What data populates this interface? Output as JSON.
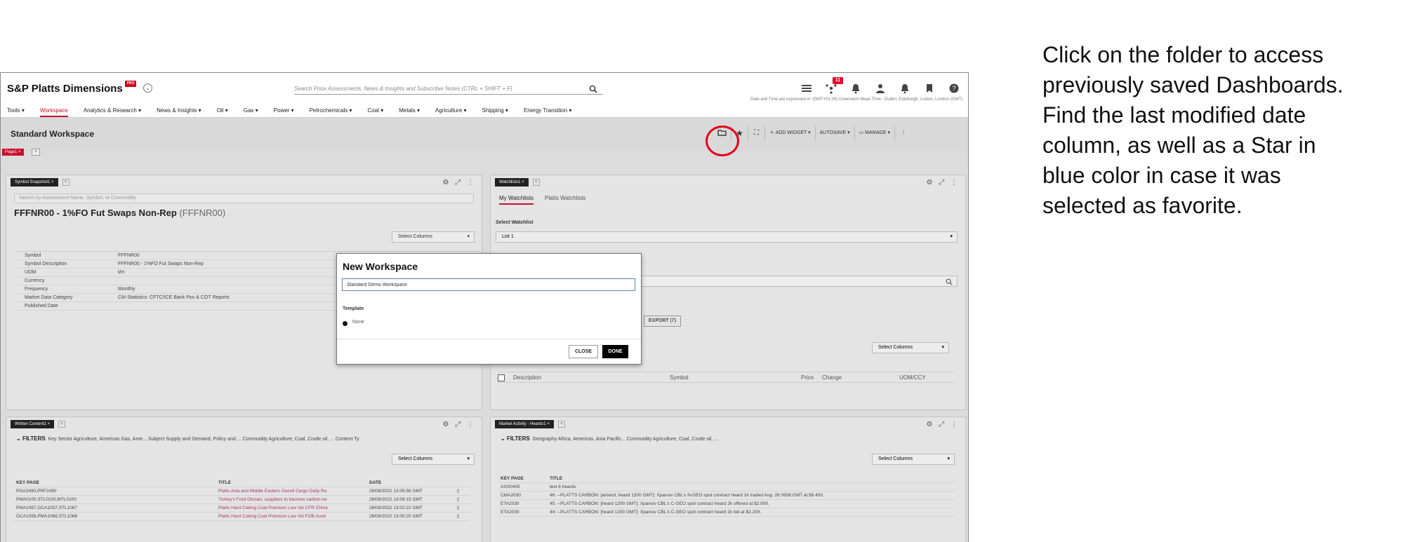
{
  "app": {
    "brand": "S&P Platts Dimensions",
    "brand_badge": "PRO",
    "search_placeholder": "Search Price Assessments, News & Insights and Subscriber Notes (CTRL + SHIFT + F)",
    "notification_count": "11",
    "timezone_text": "Date and Time are expressed in: (GMT+01:00) Greenwich Mean Time : Dublin, Edinburgh, Lisbon, London (GMT)"
  },
  "menu": [
    {
      "label": "Tools",
      "active": false
    },
    {
      "label": "Workspace",
      "active": true
    },
    {
      "label": "Analytics & Research",
      "active": false
    },
    {
      "label": "News & Insights",
      "active": false
    },
    {
      "label": "Oil",
      "active": false
    },
    {
      "label": "Gas",
      "active": false
    },
    {
      "label": "Power",
      "active": false
    },
    {
      "label": "Petrochemicals",
      "active": false
    },
    {
      "label": "Coal",
      "active": false
    },
    {
      "label": "Metals",
      "active": false
    },
    {
      "label": "Agriculture",
      "active": false
    },
    {
      "label": "Shipping",
      "active": false
    },
    {
      "label": "Energy Transition",
      "active": false
    }
  ],
  "workspace": {
    "title": "Standard Workspace",
    "page_tab": "Page1",
    "toolbar": {
      "add_widget": "ADD WIDGET",
      "autosave": "AUTOSAVE",
      "manage": "MANAGE"
    }
  },
  "symbol_snapshot": {
    "tab": "Symbol Snapshot1",
    "search_placeholder": "Search by Assessment Name, Symbol, or Commodity",
    "title": "FFFNR00 - 1%FO Fut Swaps Non-Rep",
    "title_code": "(FFFNR00)",
    "select_columns": "Select Columns",
    "rows": [
      {
        "key": "Symbol",
        "value": "FFFNR00"
      },
      {
        "key": "Symbol Description",
        "value": "FFFNR00 - 1%FO Fut Swaps Non-Rep"
      },
      {
        "key": "UOM",
        "value": "t/m"
      },
      {
        "key": "Currency",
        "value": ""
      },
      {
        "key": "Frequency",
        "value": "Monthly"
      },
      {
        "key": "Market Data Category",
        "value": "CM-Statistics: CFTC/ICE Bank Pos & COT Reports"
      },
      {
        "key": "Published Date",
        "value": ""
      }
    ]
  },
  "watchlist": {
    "tab": "Watchlists1",
    "subtab_active": "My Watchlists",
    "subtab_other": "Platts Watchlists",
    "select_label": "Select Watchlist",
    "selected": "List 1",
    "export": "EXPORT (7)",
    "select_columns": "Select Columns",
    "col_description": "Description",
    "col_symbol": "Symbol",
    "col_price": "Price",
    "col_change": "Change",
    "col_uom": "UOM/CCY"
  },
  "written_content": {
    "tab": "Written Content1",
    "filters_label": "FILTERS",
    "filters_text": "Key Sector Agriculture, Americas Gas, Ame...  Subject Supply and Demand, Policy and ...  Commodity Agriculture, Coal, Crude oil, ...  Content Ty",
    "select_columns": "Select Columns",
    "headers": {
      "key_page": "KEY PAGE",
      "title": "TITLE",
      "date": "DATE"
    },
    "rows": [
      {
        "key": "PGA2490,PRF2490",
        "title": "Platts Asia and Middle Eastern Gasoil Cargo Daily Ra",
        "date": "26/08/2022 13:09:56 GMT"
      },
      {
        "key": "PMA0100,STL0100,MTL0100",
        "title": "Turkey's Ford Otosan, suppliers to become carbon-ne",
        "date": "26/08/2022 13:09:15 GMT"
      },
      {
        "key": "PMA1067,GCA1057,STL1067",
        "title": "Platts Hard Coking Coal Premium Low Vol CFR China",
        "date": "26/08/2022 13:02:22 GMT"
      },
      {
        "key": "GCA1058,PMA1068,STL1068",
        "title": "Platts Hard Coking Coal Premium Low Vol FOB Austr",
        "date": "26/08/2022 13:00:20 GMT"
      }
    ]
  },
  "market_activity": {
    "tab": "Market Activity - Heards1",
    "filters_label": "FILTERS",
    "filters_text": "Geography Africa, Americas, Asia Pacific...  Commodity Agriculture, Coal, Crude oil, ...",
    "select_columns": "Select Columns",
    "headers": {
      "key_page": "KEY PAGE",
      "title": "TITLE"
    },
    "rows": [
      {
        "key": "AXX0400",
        "title": "test 8 heards"
      },
      {
        "key": "CMA2030",
        "title": "46: --PLATTS CARBON: [amend, heard 1200 GMT]: Xpansiv CBL's N-GEO spot contract heard 1k traded Aug. 26 0938 GMT at $9.45/t."
      },
      {
        "key": "ETA2030",
        "title": "45: --PLATTS CARBON: [heard 1200 GMT]: Xpansiv CBL's C-GEO spot contract heard 2k offered at $2.00/t."
      },
      {
        "key": "ETA2030",
        "title": "44: --PLATTS CARBON: [heard 1200 GMT]: Xpansiv CBL's C-GEO spot contract heard 2k bid at $2.20/t."
      }
    ]
  },
  "modal": {
    "title": "New Workspace",
    "input_value": "Standard Demo Workspace",
    "template_label": "Template",
    "template_option": "None",
    "close_label": "CLOSE",
    "done_label": "DONE"
  },
  "instruction": {
    "lines": [
      "Click on the folder to access",
      "previously saved Dashboards.",
      "Find the last modified date",
      "column, as well as a Star in",
      "blue color in case it was",
      "selected as favorite."
    ]
  },
  "colors": {
    "brand_red": "#c8102e",
    "highlight_ring": "#e4001b",
    "done_button": "#000000"
  }
}
